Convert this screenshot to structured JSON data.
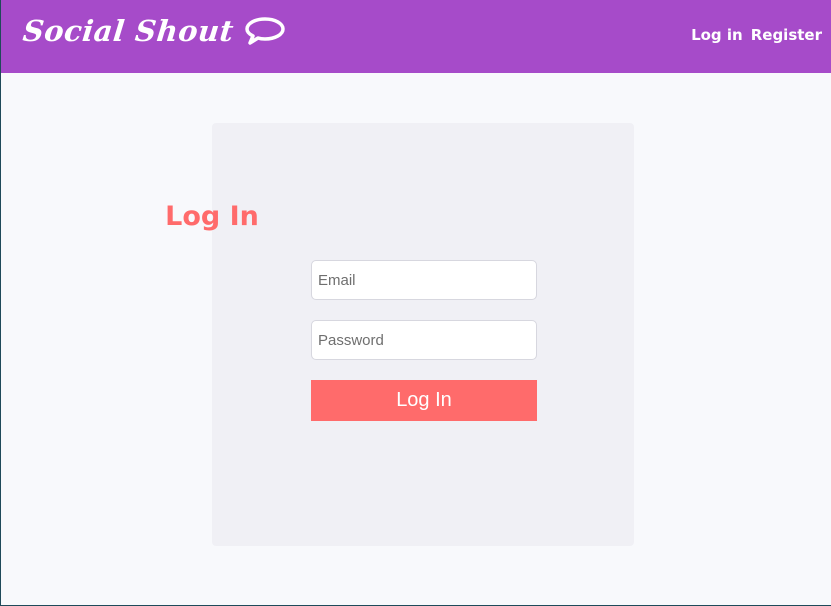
{
  "header": {
    "brand": "Social Shout",
    "brand_icon": "speech-bubble-icon",
    "nav": {
      "login": "Log in",
      "register": "Register"
    },
    "background": "#a64bc9"
  },
  "login_form": {
    "title": "Log In",
    "email_placeholder": "Email",
    "password_placeholder": "Password",
    "submit_label": "Log In",
    "accent": "#ff6b6b"
  }
}
